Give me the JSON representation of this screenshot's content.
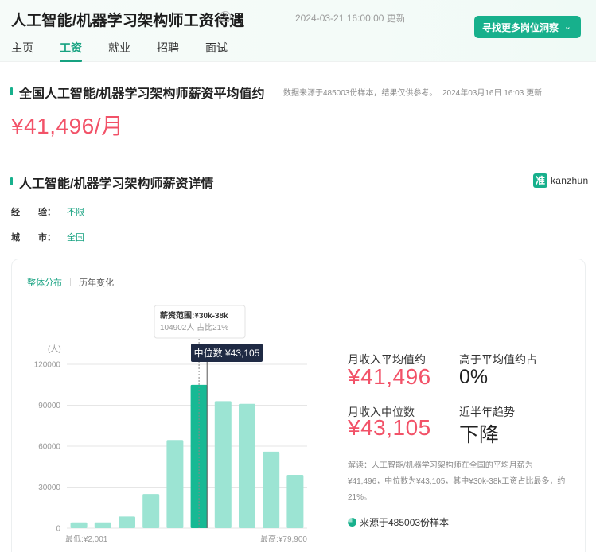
{
  "header": {
    "title": "人工智能/机器学习架构师工资待遇",
    "update_time": "2024-03-21 16:00:00 更新",
    "help_glyph": "?",
    "cta_label": "寻找更多岗位洞察",
    "cta_chevron": "⌄",
    "tabs": [
      "主页",
      "工资",
      "就业",
      "招聘",
      "面试"
    ],
    "active_tab": "工资"
  },
  "section_avg": {
    "title": "全国人工智能/机器学习架构师薪资平均值约",
    "source_note": "数据来源于485003份样本，结果仅供参考。",
    "time_note": "2024年03月16日 16:03 更新",
    "value": "¥41,496/月"
  },
  "section_detail": {
    "title": "人工智能/机器学习架构师薪资详情",
    "brand_mark": "准",
    "brand_text": "kanzhun",
    "filters": [
      {
        "label_a": "经",
        "label_b": "验：",
        "value": "不限"
      },
      {
        "label_a": "城",
        "label_b": "市：",
        "value": "全国"
      }
    ]
  },
  "card": {
    "subtabs": [
      "整体分布",
      "历年变化"
    ],
    "active_subtab": "整体分布"
  },
  "chart_data": {
    "type": "bar",
    "ylabel": "(人)",
    "ylim": [
      0,
      120000
    ],
    "yticks": [
      0,
      30000,
      60000,
      90000,
      120000
    ],
    "yticks_labels": [
      "0",
      "30000",
      "60000",
      "90000",
      "120000"
    ],
    "values": [
      4200,
      4200,
      8500,
      25000,
      64500,
      104902,
      93000,
      91000,
      56000,
      39000
    ],
    "highlight_index": 5,
    "x_min_label": "最低:¥2,001",
    "x_max_label": "最高:¥79,900",
    "median_position": 6.0,
    "median_label": "中位数 ¥43,105",
    "tooltip": {
      "title": "薪资范围:¥30k-38k",
      "detail": "104902人  占比21%"
    },
    "colors": {
      "bar": "#9ce4d3",
      "highlight": "#17b994",
      "axis": "#e6e6e6",
      "median_box": "#1f2a44"
    }
  },
  "stats": {
    "avg_label": "月收入平均值约",
    "avg_value": "¥41,496",
    "above_label": "高于平均值约占",
    "above_value": "0%",
    "median_label": "月收入中位数",
    "median_value": "¥43,105",
    "trend_label": "近半年趋势",
    "trend_value": "下降"
  },
  "explain": "解读：人工智能/机器学习架构师在全国的平均月薪为¥41,496，中位数为¥43,105，其中¥30k-38k工资占比最多，约21%。",
  "sample_text": "来源于485003份样本"
}
